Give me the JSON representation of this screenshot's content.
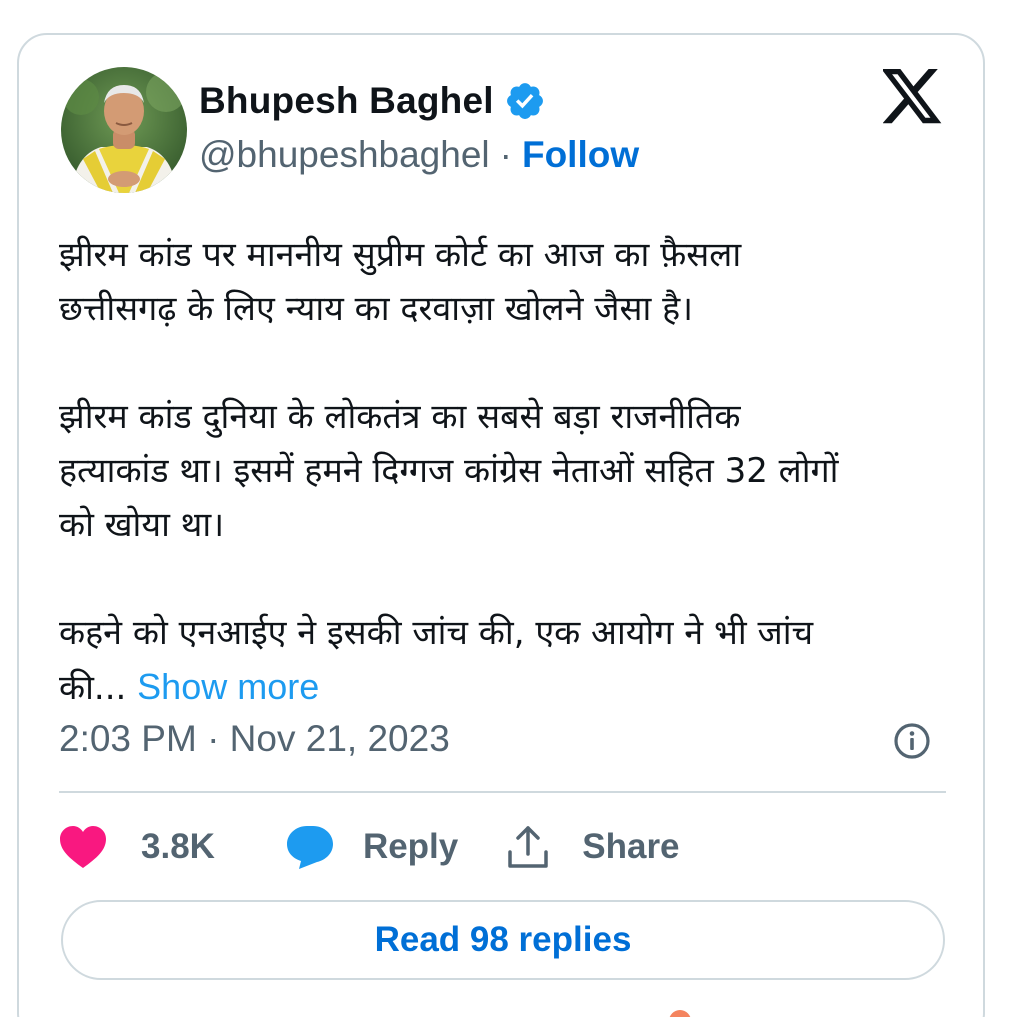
{
  "author": {
    "display_name": "Bhupesh Baghel",
    "handle": "@bhupeshbaghel",
    "separator": "·",
    "follow_label": "Follow",
    "verified_icon": "verified-badge-icon",
    "avatar": "author-avatar-photo"
  },
  "brand": {
    "logo_icon": "x-logo-icon"
  },
  "tweet": {
    "paragraphs": [
      "झीरम कांड पर माननीय सुप्रीम कोर्ट का आज का फ़ैसला\nछत्तीसगढ़ के लिए न्याय का दरवाज़ा खोलने जैसा है।",
      "झीरम कांड दुनिया के लोकतंत्र का सबसे बड़ा राजनीतिक\nहत्याकांड था। इसमें हमने दिग्गज कांग्रेस नेताओं सहित 32 लोगों\nको खोया था।",
      "कहने को एनआईए ने इसकी जांच की, एक आयोग ने भी जांच\nकी..."
    ],
    "show_more_label": "Show more",
    "timestamp": "2:03 PM · Nov 21, 2023",
    "info_icon": "info-icon"
  },
  "actions": {
    "like_count": "3.8K",
    "like_icon": "heart-icon",
    "reply_label": "Reply",
    "reply_icon": "speech-bubble-icon",
    "share_label": "Share",
    "share_icon": "share-upload-icon"
  },
  "read_replies_label": "Read 98 replies",
  "colors": {
    "accent_link": "#006fd6",
    "show_more": "#1d9bf0",
    "like": "#f91880",
    "reply_bubble": "#1d9bf0",
    "muted_text": "#536471",
    "border": "#cfd9de"
  }
}
